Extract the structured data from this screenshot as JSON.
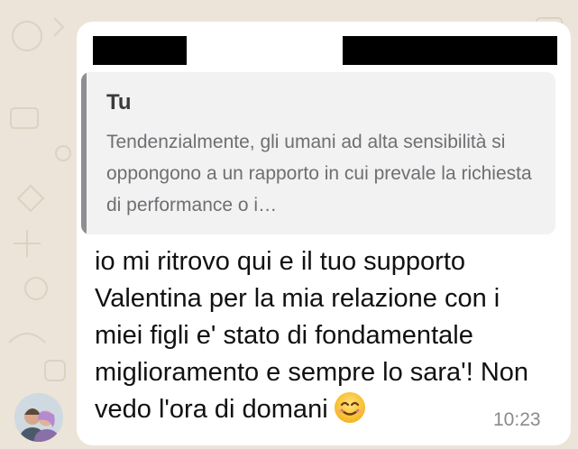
{
  "chat": {
    "quote": {
      "author": "Tu",
      "text": "Tendenzialmente, gli umani ad alta sensibilità si oppongono a un rapporto in cui prevale la richiesta di performance o i…"
    },
    "message": {
      "text": "io mi ritrovo qui e il tuo supporto Valentina per la mia relazione con i miei figli e' stato di fondamentale miglioramento e sempre lo sara'! Non vedo l'ora di domani",
      "emoji": "smiling-face-icon",
      "time": "10:23"
    },
    "sender_avatar": "avatar-photo"
  },
  "colors": {
    "wallpaper": "#ece4d8",
    "bubble": "#ffffff",
    "quote_background": "#f2f2f3",
    "quote_bar": "#8e8e93",
    "redaction": "#000000"
  }
}
